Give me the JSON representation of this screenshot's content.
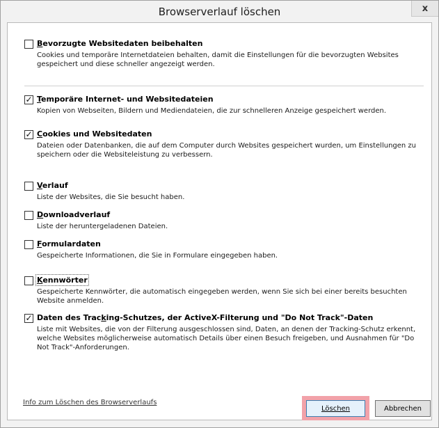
{
  "dialog": {
    "title": "Browserverlauf löschen",
    "close_symbol": "x"
  },
  "options": [
    {
      "id": "preserve",
      "checked": false,
      "title_accel": "B",
      "title_rest": "evorzugte Websitedaten beibehalten",
      "title_pre": "",
      "desc": "Cookies und temporäre Internetdateien behalten, damit die Einstellungen für die bevorzugten Websites gespeichert und diese schneller angezeigt werden."
    },
    {
      "id": "temp",
      "checked": true,
      "title_pre": "",
      "title_accel": "T",
      "title_rest": "emporäre Internet- und Websitedateien",
      "desc": "Kopien von Webseiten, Bildern und Mediendateien, die zur schnelleren Anzeige gespeichert werden."
    },
    {
      "id": "cookies",
      "checked": true,
      "title_pre": "",
      "title_accel": "C",
      "title_rest": "ookies und Websitedaten",
      "desc": "Dateien oder Datenbanken, die auf dem Computer durch Websites gespeichert wurden, um Einstellungen zu speichern oder die Websiteleistung zu verbessern."
    },
    {
      "id": "history",
      "checked": false,
      "title_pre": "",
      "title_accel": "V",
      "title_rest": "erlauf",
      "desc": "Liste der Websites, die Sie besucht haben."
    },
    {
      "id": "downloads",
      "checked": false,
      "title_pre": "",
      "title_accel": "D",
      "title_rest": "ownloadverlauf",
      "desc": "Liste der heruntergeladenen Dateien."
    },
    {
      "id": "forms",
      "checked": false,
      "title_pre": "",
      "title_accel": "F",
      "title_rest": "ormulardaten",
      "desc": "Gespeicherte Informationen, die Sie in Formulare eingegeben haben."
    },
    {
      "id": "passwords",
      "checked": false,
      "title_pre": "",
      "title_accel": "K",
      "title_rest": "ennwörter",
      "desc": "Gespeicherte Kennwörter, die automatisch eingegeben werden, wenn Sie sich bei einer bereits besuchten Website anmelden."
    },
    {
      "id": "tracking",
      "checked": true,
      "title_pre": "Daten des Trac",
      "title_accel": "k",
      "title_rest": "ing-Schutzes, der ActiveX-Filterung und \"Do Not Track\"-Daten",
      "desc": "Liste mit Websites, die von der Filterung ausgeschlossen sind, Daten, an denen der Tracking-Schutz erkennt, welche Websites möglicherweise automatisch Details über einen Besuch freigeben, und Ausnahmen für \"Do Not Track\"-Anforderungen."
    }
  ],
  "footer": {
    "info_link": "Info zum Löschen des Browserverlaufs",
    "delete_label": "Löschen",
    "cancel_label": "Abbrechen"
  },
  "check_symbol": "✓"
}
